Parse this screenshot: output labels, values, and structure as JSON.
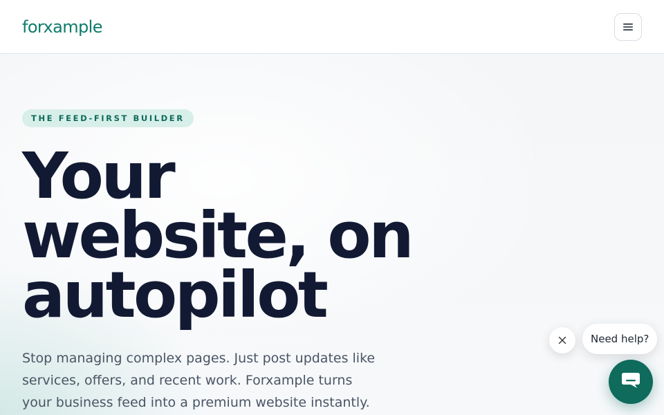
{
  "header": {
    "logo": "forxample",
    "menu_icon": "hamburger-menu-icon"
  },
  "hero": {
    "eyebrow": "THE FEED-FIRST BUILDER",
    "headline_line1": "Your",
    "headline_line2": "website, on",
    "headline_line3": "autopilot",
    "subtext": "Stop managing complex pages. Just post updates like services, offers, and recent work. Forxample turns your business feed into a premium website instantly."
  },
  "chat": {
    "prompt": "Need help?",
    "close_icon": "close-icon",
    "launcher_icon": "chat-bubble-icon"
  },
  "colors": {
    "brand": "#0f7b6c",
    "launcher": "#0f6b5c",
    "headline": "#121a33",
    "eyebrow_bg": "#d8efe9"
  }
}
